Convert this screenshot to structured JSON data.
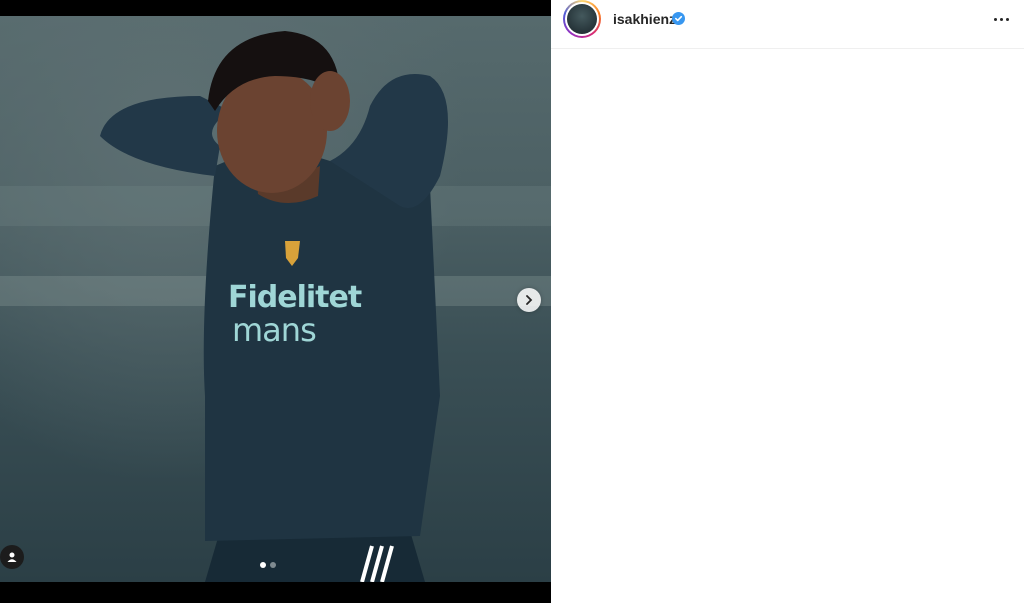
{
  "post": {
    "username": "isakhienz",
    "verified": true,
    "carousel": {
      "total_slides": 2,
      "active_slide": 1
    },
    "jersey_sponsor_line1": "Fidelitet",
    "jersey_sponsor_line2": "mans"
  },
  "icons": {
    "next": "chevron-right-icon",
    "tags": "user-tag-icon",
    "more": "more-options-icon",
    "verified": "verified-badge-icon"
  },
  "colors": {
    "jersey": "#1f3442",
    "sponsor_text": "#9fd6d6",
    "verified_blue": "#3897f0"
  }
}
